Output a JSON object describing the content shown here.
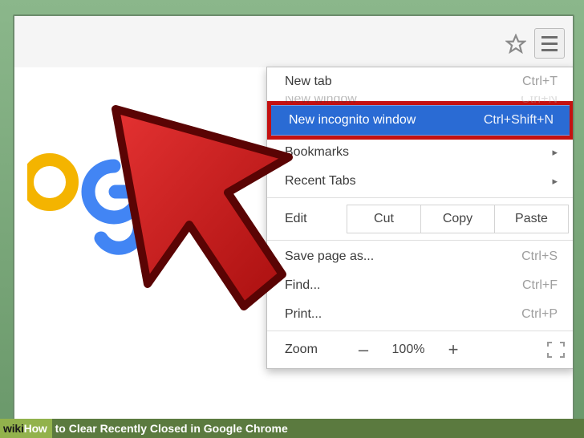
{
  "menu": {
    "new_tab": {
      "label": "New tab",
      "shortcut": "Ctrl+T"
    },
    "new_window": {
      "label": "New window",
      "shortcut": "Ctrl+N"
    },
    "incognito": {
      "label": "New incognito window",
      "shortcut": "Ctrl+Shift+N"
    },
    "bookmarks": {
      "label": "Bookmarks"
    },
    "recent_tabs": {
      "label": "Recent Tabs"
    },
    "edit": {
      "label": "Edit",
      "cut": "Cut",
      "copy": "Copy",
      "paste": "Paste"
    },
    "save_as": {
      "label": "Save page as...",
      "shortcut": "Ctrl+S"
    },
    "find": {
      "label": "Find...",
      "shortcut": "Ctrl+F"
    },
    "print": {
      "label": "Print...",
      "shortcut": "Ctrl+P"
    },
    "zoom": {
      "label": "Zoom",
      "minus": "–",
      "value": "100%",
      "plus": "+"
    }
  },
  "caption": {
    "brand_wiki": "wiki",
    "brand_how": "How",
    "title": " to Clear Recently Closed in Google Chrome"
  }
}
